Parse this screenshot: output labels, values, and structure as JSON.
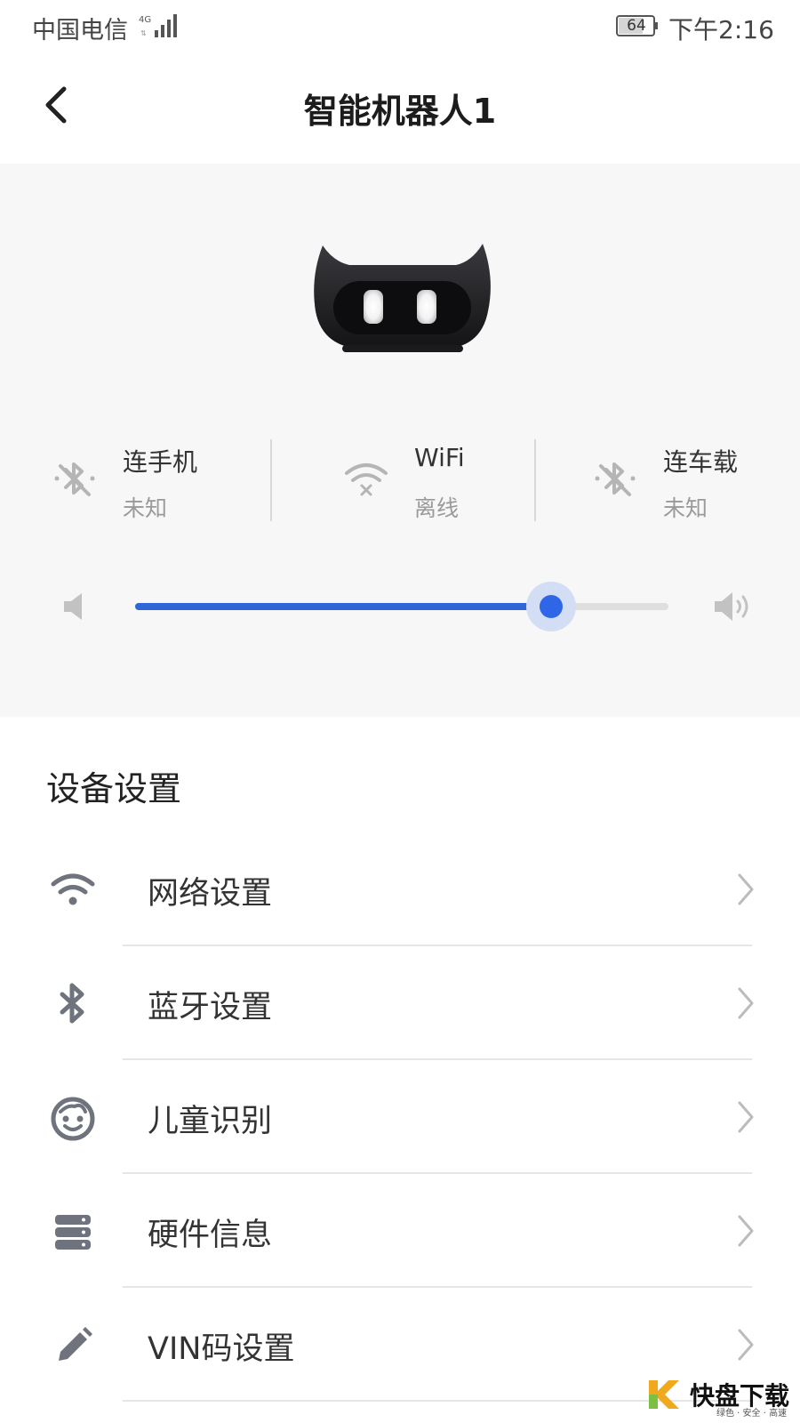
{
  "status_bar": {
    "carrier": "中国电信",
    "network": "4G",
    "battery": "64",
    "time": "下午2:16"
  },
  "nav": {
    "title": "智能机器人1"
  },
  "device": {
    "connections": [
      {
        "label": "连手机",
        "value": "未知",
        "icon": "bluetooth-disconnected-icon"
      },
      {
        "label": "WiFi",
        "value": "离线",
        "icon": "wifi-off-icon"
      },
      {
        "label": "连车载",
        "value": "未知",
        "icon": "bluetooth-disconnected-icon"
      }
    ],
    "volume_fraction": 0.78
  },
  "settings": {
    "title": "设备设置",
    "items": [
      {
        "label": "网络设置",
        "icon": "wifi-icon"
      },
      {
        "label": "蓝牙设置",
        "icon": "bluetooth-icon"
      },
      {
        "label": "儿童识别",
        "icon": "face-icon"
      },
      {
        "label": "硬件信息",
        "icon": "server-icon"
      },
      {
        "label": "VIN码设置",
        "icon": "pencil-icon"
      }
    ]
  },
  "watermark": {
    "main": "快盘下载",
    "sub": "绿色 · 安全 · 高速"
  },
  "colors": {
    "accent": "#2f66e8",
    "panel_bg": "#f7f7f7",
    "icon_gray": "#6e737d"
  }
}
